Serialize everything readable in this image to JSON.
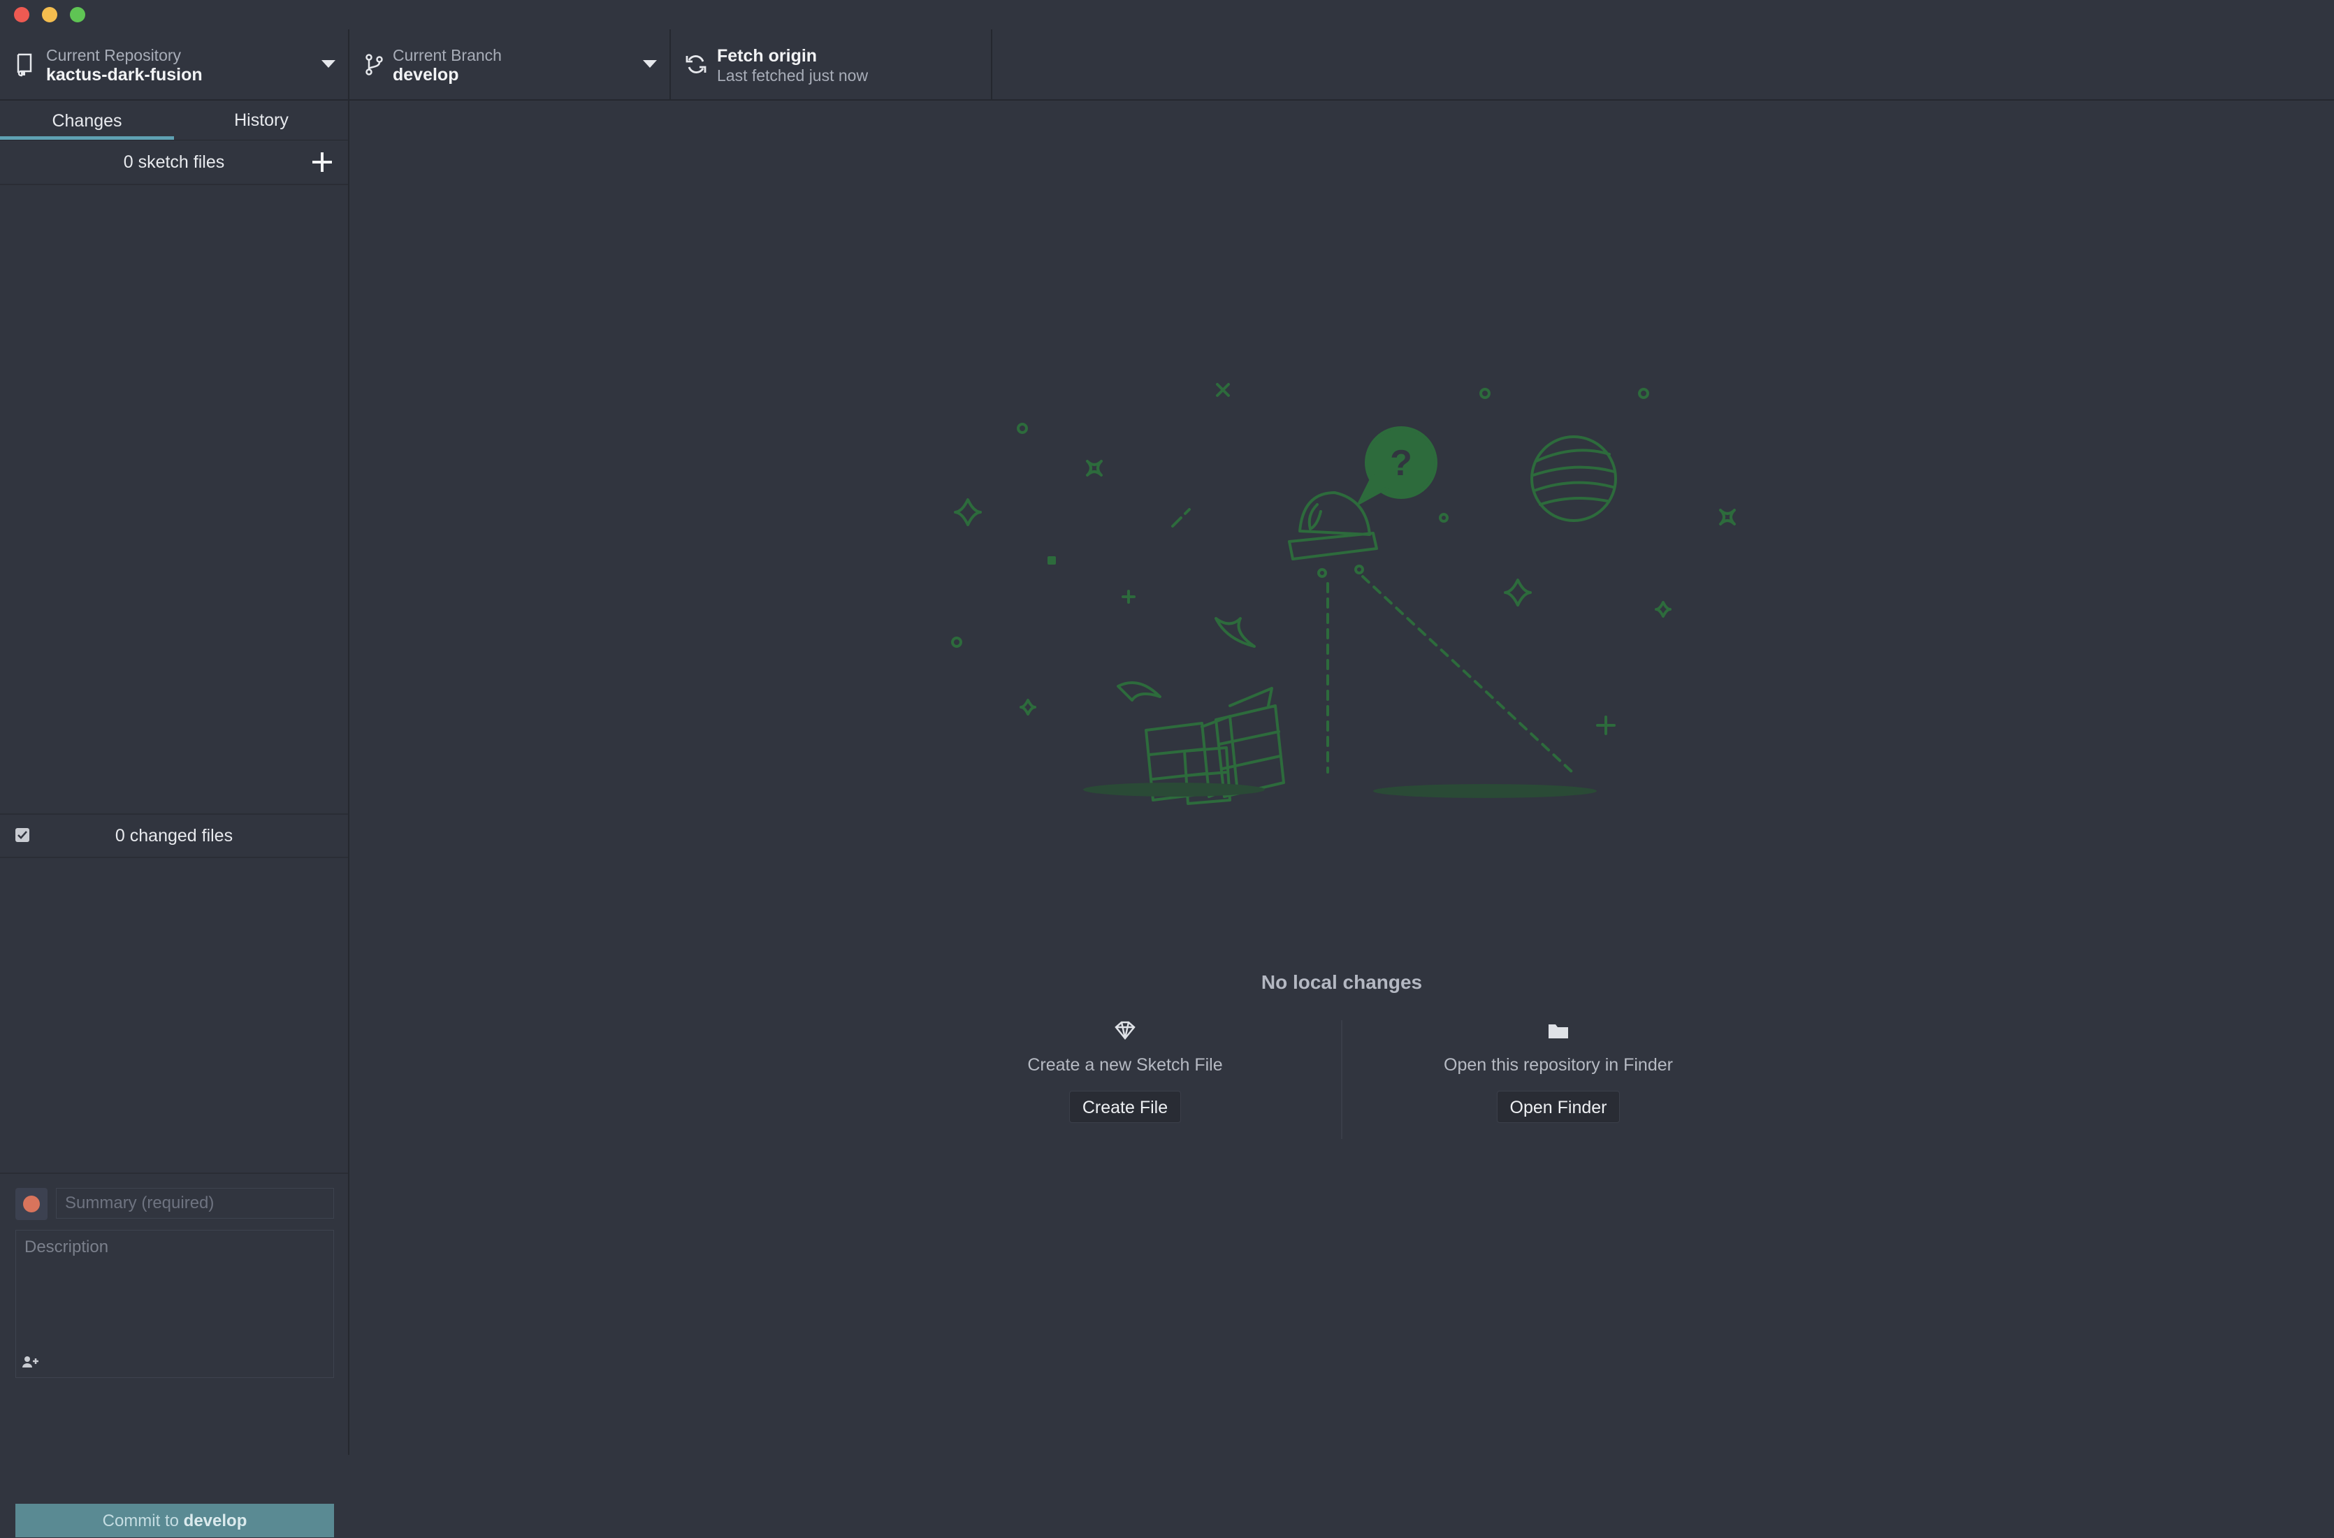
{
  "toolbar": {
    "repository": {
      "label": "Current Repository",
      "value": "kactus-dark-fusion"
    },
    "branch": {
      "label": "Current Branch",
      "value": "develop"
    },
    "fetch": {
      "label": "Fetch origin",
      "sublabel": "Last fetched just now"
    }
  },
  "sidebar": {
    "tabs": [
      {
        "label": "Changes",
        "active": true
      },
      {
        "label": "History",
        "active": false
      }
    ],
    "sketch_files": "0 sketch files",
    "changed_files": "0 changed files",
    "commit": {
      "summary_placeholder": "Summary (required)",
      "description_placeholder": "Description",
      "button_prefix": "Commit to",
      "button_branch": "develop"
    }
  },
  "main": {
    "empty_title": "No local changes",
    "actions": [
      {
        "description": "Create a new Sketch File",
        "button": "Create File",
        "icon": "sketch-diamond-icon"
      },
      {
        "description": "Open this repository in Finder",
        "button": "Open Finder",
        "icon": "folder-icon"
      }
    ]
  },
  "colors": {
    "background": "#31353f",
    "accent": "#5fa1b3",
    "illustration": "#2d6b3c",
    "commit_button": "#5a8a93"
  }
}
